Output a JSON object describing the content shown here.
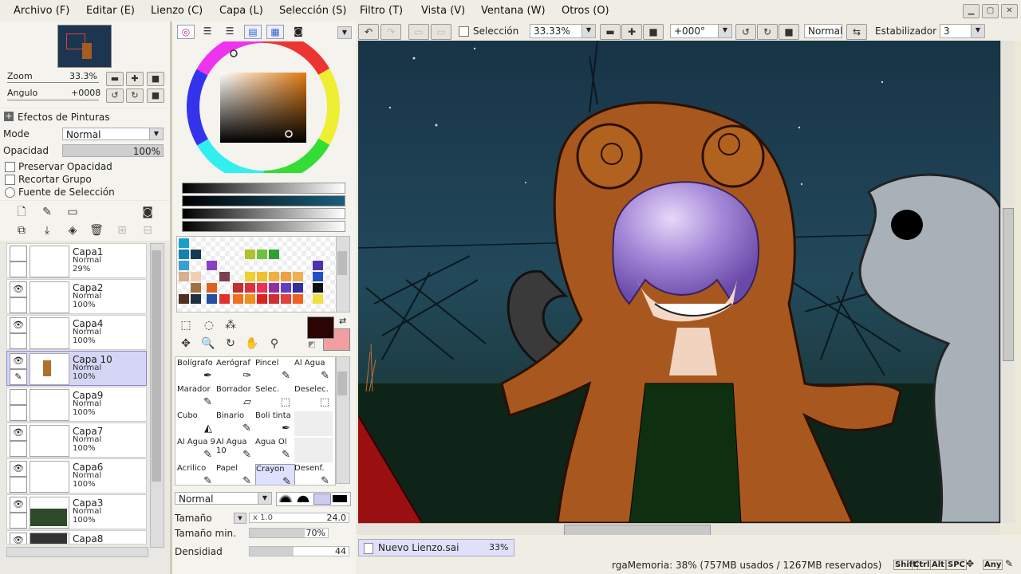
{
  "menubar": {
    "items": [
      "Archivo (F)",
      "Editar (E)",
      "Lienzo (C)",
      "Capa (L)",
      "Selección (S)",
      "Filtro (T)",
      "Vista (V)",
      "Ventana (W)",
      "Otros (O)"
    ]
  },
  "navigator": {
    "zoom_label": "Zoom",
    "zoom_value": "33.3%",
    "angle_label": "Angulo",
    "angle_value": "+0008"
  },
  "layer_panel": {
    "effects_label": "Efectos de Pinturas",
    "mode_label": "Mode",
    "mode_value": "Normal",
    "opacity_label": "Opacidad",
    "opacity_value": "100%",
    "opacity_fraction": 1.0,
    "preserve_opacity": "Preservar Opacidad",
    "clip_group": "Recortar Grupo",
    "selection_source": "Fuente de Selección",
    "layers": [
      {
        "name": "Capa1",
        "mode": "Normal",
        "opacity": "29%",
        "visible": false,
        "selected": false
      },
      {
        "name": "Capa2",
        "mode": "Normal",
        "opacity": "100%",
        "visible": true,
        "selected": false
      },
      {
        "name": "Capa4",
        "mode": "Normal",
        "opacity": "100%",
        "visible": true,
        "selected": false
      },
      {
        "name": "Capa 10",
        "mode": "Normal",
        "opacity": "100%",
        "visible": true,
        "selected": true
      },
      {
        "name": "Capa9",
        "mode": "Normal",
        "opacity": "100%",
        "visible": false,
        "selected": false
      },
      {
        "name": "Capa7",
        "mode": "Normal",
        "opacity": "100%",
        "visible": true,
        "selected": false
      },
      {
        "name": "Capa6",
        "mode": "Normal",
        "opacity": "100%",
        "visible": true,
        "selected": false
      },
      {
        "name": "Capa3",
        "mode": "Normal",
        "opacity": "100%",
        "visible": true,
        "selected": false
      },
      {
        "name": "Capa8",
        "mode": "",
        "opacity": "",
        "visible": true,
        "selected": false
      }
    ]
  },
  "brushes": [
    [
      "Bolígrafo",
      "Aerógraf",
      "Pincel",
      "Al Agua"
    ],
    [
      "Marador",
      "Borrador",
      "Selec.",
      "Deselec."
    ],
    [
      "Cubo",
      "Binario",
      "Boli tinta",
      ""
    ],
    [
      "Al Agua 9",
      "Al Agua 10",
      "Agua Ol",
      ""
    ],
    [
      "Acrilico",
      "Papel",
      "Crayon",
      "Desenf."
    ]
  ],
  "brush_settings": {
    "blend_mode": "Normal",
    "size_label": "Tamaño",
    "size_mult": "x 1.0",
    "size_value": "24.0",
    "min_size_label": "Tamaño min.",
    "min_size_value": "70%",
    "min_size_fraction": 0.7,
    "density_label": "Densidiad",
    "density_value": "44",
    "density_fraction": 0.44
  },
  "colors": {
    "primary": "#2a0503",
    "secondary": "#f0a0a0"
  },
  "toolbar": {
    "selection_label": "Selección",
    "zoom_value": "33.33%",
    "angle_value": "+000°",
    "mode_value": "Normal",
    "stabilizer_label": "Estabilizador",
    "stabilizer_value": "3"
  },
  "statusbar": {
    "doc_tab": "Nuevo Lienzo.sai",
    "doc_zoom": "33%",
    "memory": "rgaMemoria: 38% (757MB usados / 1267MB reservados)",
    "keys": [
      "Shift",
      "Ctrl",
      "Alt",
      "SPC",
      "Any"
    ]
  }
}
